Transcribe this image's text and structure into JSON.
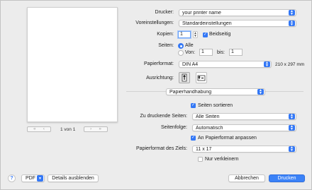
{
  "preview": {
    "prev_first": "«",
    "prev": "‹",
    "next": "›",
    "next_last": "»",
    "page_indicator": "1 von 1"
  },
  "printer": {
    "label": "Drucker:",
    "value": "your printer name"
  },
  "presets": {
    "label": "Voreinstellungen:",
    "value": "Standardeinstellungen"
  },
  "copies": {
    "label": "Kopien:",
    "value": "1",
    "duplex_label": "Beidseitig",
    "duplex_checked": true
  },
  "pages": {
    "label": "Seiten:",
    "all_label": "Alle",
    "from_label": "Von:",
    "from_value": "1",
    "to_label": "bis:",
    "to_value": "1",
    "selected": "all"
  },
  "paper": {
    "label": "Papierformat:",
    "value": "DIN A4",
    "size_text": "210 x 297 mm"
  },
  "orientation": {
    "label": "Ausrichtung:",
    "selected": "portrait"
  },
  "section": {
    "value": "Papierhandhabung"
  },
  "collate": {
    "label": "Seiten sortieren",
    "checked": true
  },
  "pages_to_print": {
    "label": "Zu druckende Seiten:",
    "value": "Alle Seiten"
  },
  "page_order": {
    "label": "Seitenfolge:",
    "value": "Automatisch"
  },
  "scale_to_fit": {
    "label": "An Papierformat anpassen",
    "checked": true
  },
  "dest_paper": {
    "label": "Papierformat des Ziels:",
    "value": "11 x 17"
  },
  "scale_down_only": {
    "label": "Nur verkleinern",
    "checked": false
  },
  "bottom": {
    "help": "?",
    "pdf": "PDF",
    "details": "Details ausblenden",
    "cancel": "Abbrechen",
    "print": "Drucken"
  },
  "colors": {
    "accent": "#3478f6",
    "background": "#ececec"
  }
}
